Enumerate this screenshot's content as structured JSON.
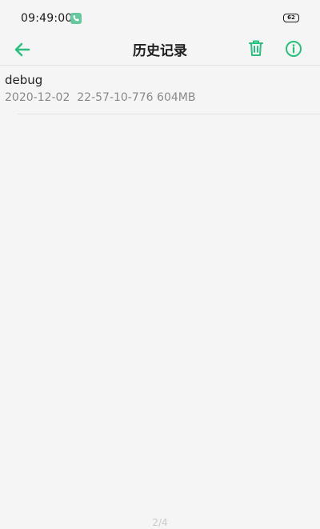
{
  "status_bar": {
    "time": "09:49:00",
    "battery": "62",
    "call_icon": "phone-icon"
  },
  "header": {
    "title": "历史记录",
    "back_icon": "arrow-left-icon",
    "delete_icon": "trash-icon",
    "info_icon": "info-icon",
    "accent_color": "#2bbf7f"
  },
  "records": [
    {
      "name": "debug",
      "meta": "2020-12-02  22-57-10-776 604MB"
    }
  ],
  "footer": {
    "page_indicator": "2/4"
  }
}
